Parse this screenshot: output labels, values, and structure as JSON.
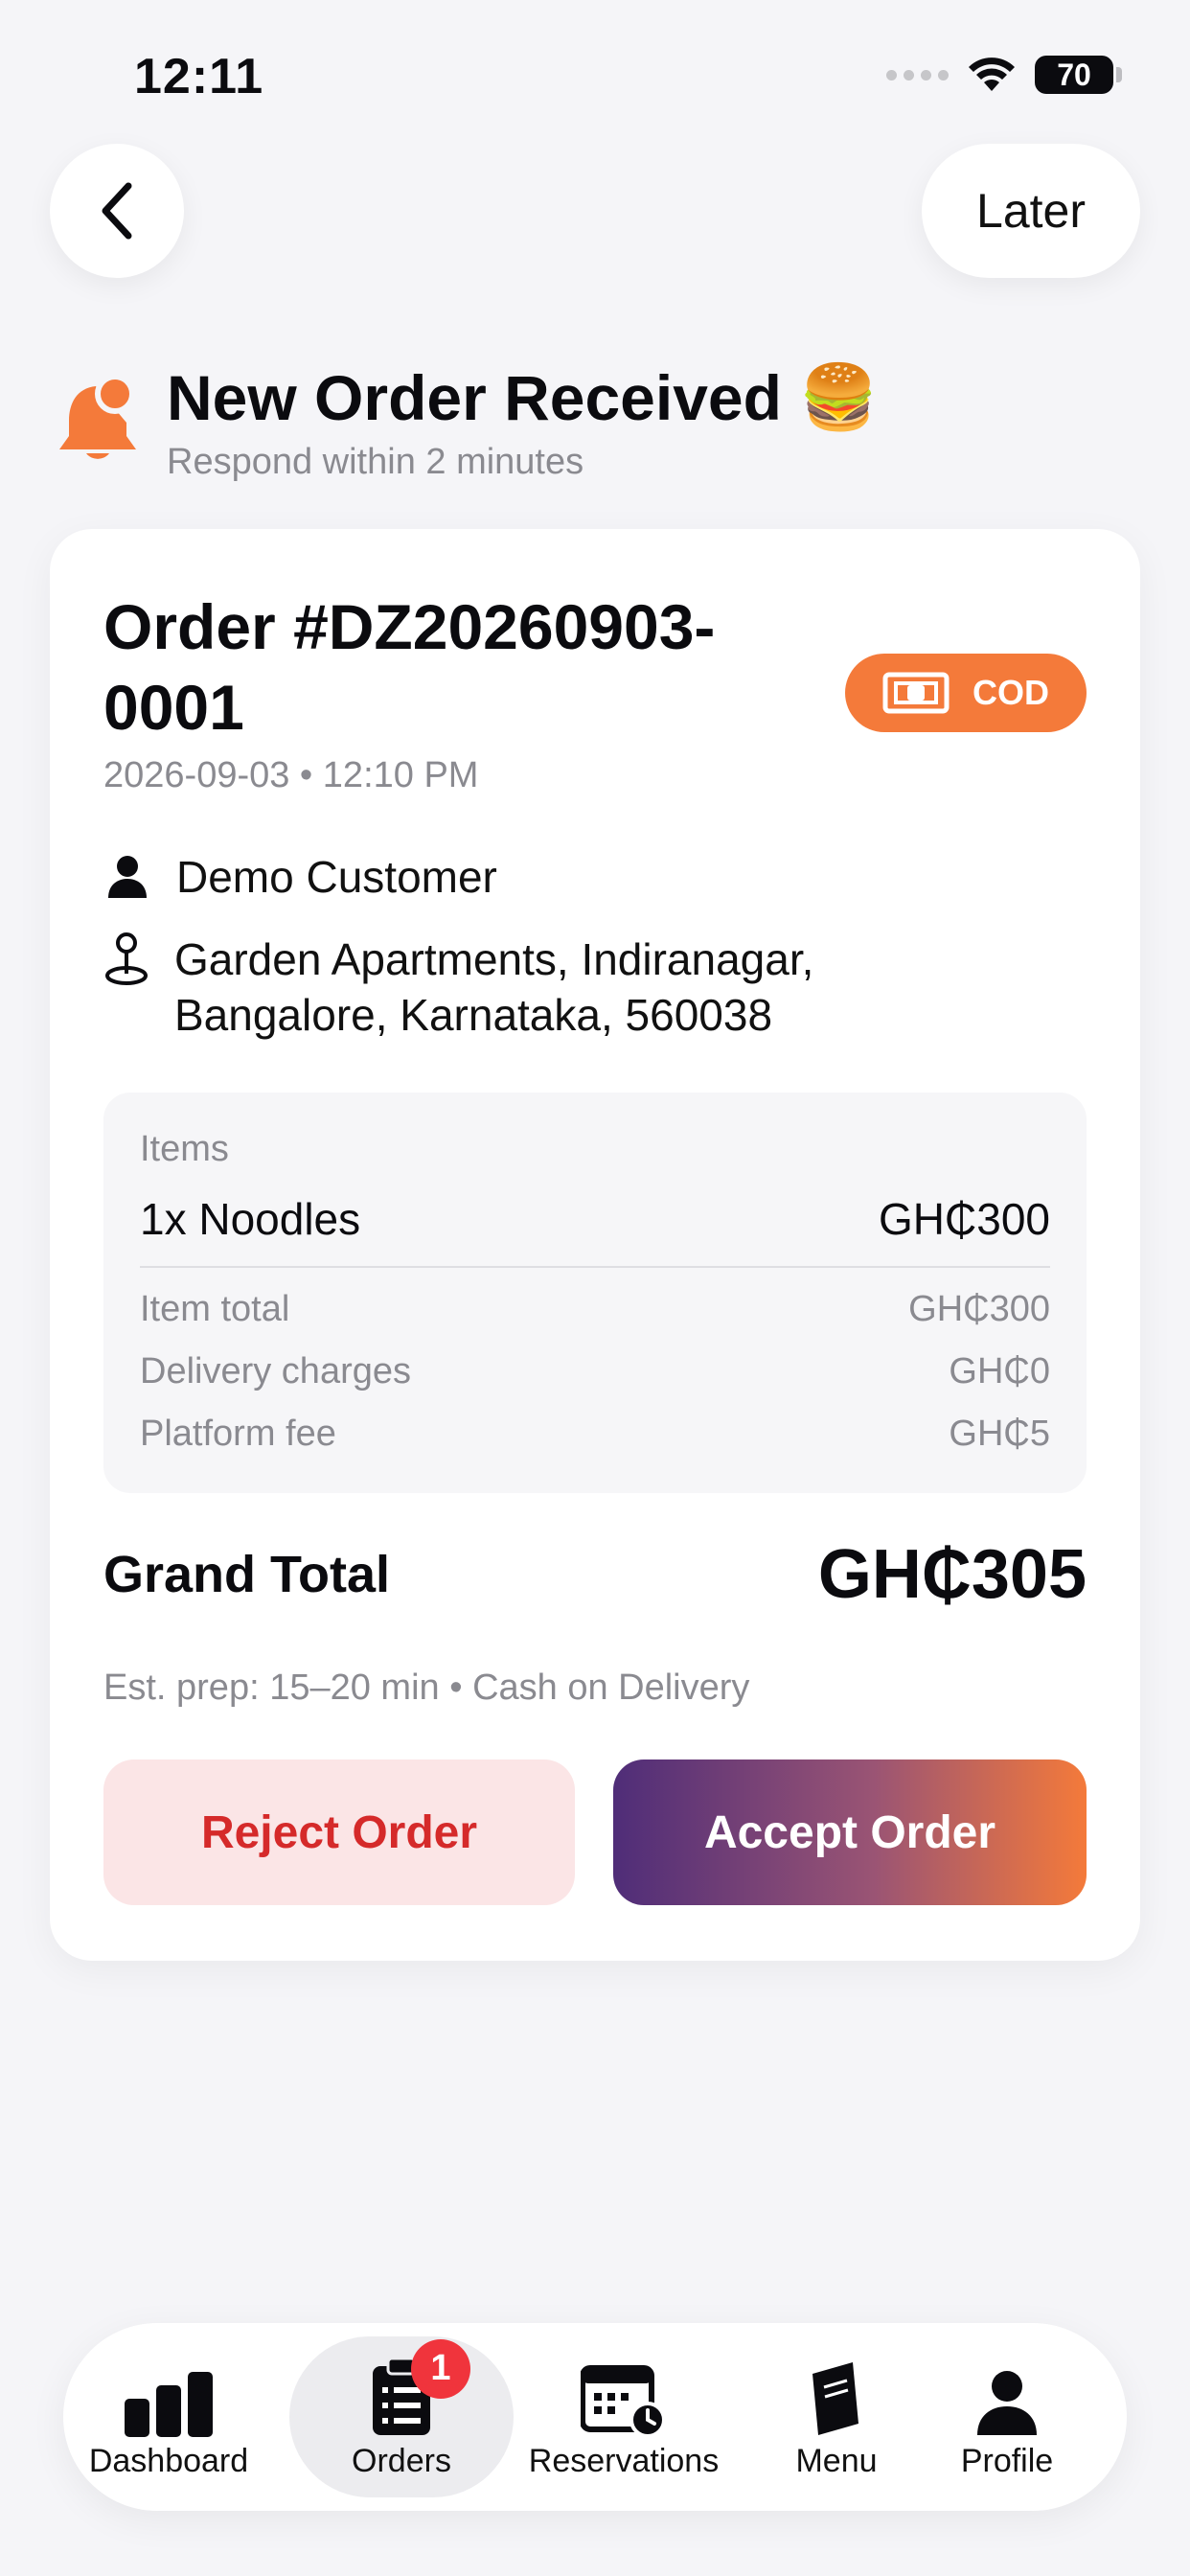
{
  "status_bar": {
    "time": "12:11",
    "battery": "70"
  },
  "nav": {
    "later_label": "Later"
  },
  "header": {
    "title": "New Order Received",
    "emoji": "🍔",
    "subtitle": "Respond within 2 minutes",
    "icon": "bell-icon"
  },
  "order": {
    "title": "Order #DZ20260903-0001",
    "payment_badge": "COD",
    "datetime": "2026-09-03 • 12:10 PM",
    "customer": "Demo Customer",
    "address": "Garden Apartments, Indiranagar, Bangalore, Karnataka, 560038",
    "items_label": "Items",
    "items": [
      {
        "name": "1x Noodles",
        "price": "GH₵300"
      }
    ],
    "fees": [
      {
        "label": "Item total",
        "value": "GH₵300"
      },
      {
        "label": "Delivery charges",
        "value": "GH₵0"
      },
      {
        "label": "Platform fee",
        "value": "GH₵5"
      }
    ],
    "grand_total_label": "Grand Total",
    "grand_total_value": "GH₵305",
    "prep_info": "Est. prep: 15–20 min • Cash on Delivery",
    "reject_label": "Reject Order",
    "accept_label": "Accept Order"
  },
  "tabs": [
    {
      "label": "Dashboard",
      "icon": "bar-chart-icon"
    },
    {
      "label": "Orders",
      "icon": "clipboard-icon",
      "badge": "1",
      "active": true
    },
    {
      "label": "Reservations",
      "icon": "calendar-clock-icon"
    },
    {
      "label": "Menu",
      "icon": "menu-book-icon"
    },
    {
      "label": "Profile",
      "icon": "person-icon"
    }
  ],
  "colors": {
    "accent_orange": "#f47a3a",
    "accent_purple": "#4f2d78",
    "reject_bg": "#fbe5e6",
    "reject_text": "#d52a2a",
    "badge_red": "#f0343c"
  }
}
